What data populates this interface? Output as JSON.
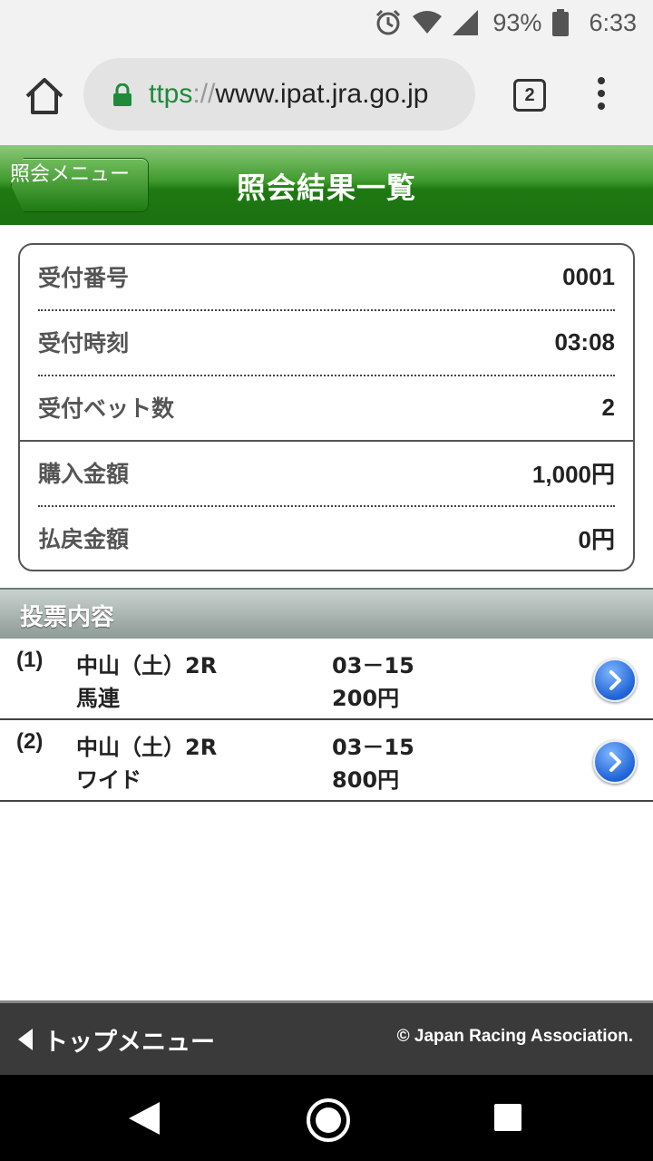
{
  "status_bar": {
    "battery_percent": "93%",
    "time": "6:33",
    "icons": [
      "alarm-icon",
      "wifi-icon",
      "signal-icon",
      "battery-icon"
    ]
  },
  "browser": {
    "url_scheme": "ttps",
    "url_separator": "://",
    "url_host": "www.ipat.jra.go.jp",
    "tab_count": "2"
  },
  "header": {
    "back_button_label": "照会メニュー",
    "title": "照会結果一覧"
  },
  "summary": {
    "rows": [
      {
        "label": "受付番号",
        "value": "0001"
      },
      {
        "label": "受付時刻",
        "value": "03:08"
      },
      {
        "label": "受付ベット数",
        "value": "2"
      },
      {
        "label": "購入金額",
        "value": "1,000円"
      },
      {
        "label": "払戻金額",
        "value": "0円"
      }
    ]
  },
  "bets": {
    "section_title": "投票内容",
    "items": [
      {
        "num": "(1)",
        "race": "中山（土）2R",
        "type": "馬連",
        "combo": "03－15",
        "amount": "200円"
      },
      {
        "num": "(2)",
        "race": "中山（土）2R",
        "type": "ワイド",
        "combo": "03－15",
        "amount": "800円"
      }
    ]
  },
  "footer": {
    "top_menu_label": "トップメニュー",
    "copyright": "© Japan Racing Association."
  },
  "colors": {
    "header_green": "#1f7a12",
    "section_gray": "#8e9a96",
    "footer_dark": "#3a3a3a",
    "link_blue": "#1f63d6",
    "url_green": "#1e8a3a"
  }
}
